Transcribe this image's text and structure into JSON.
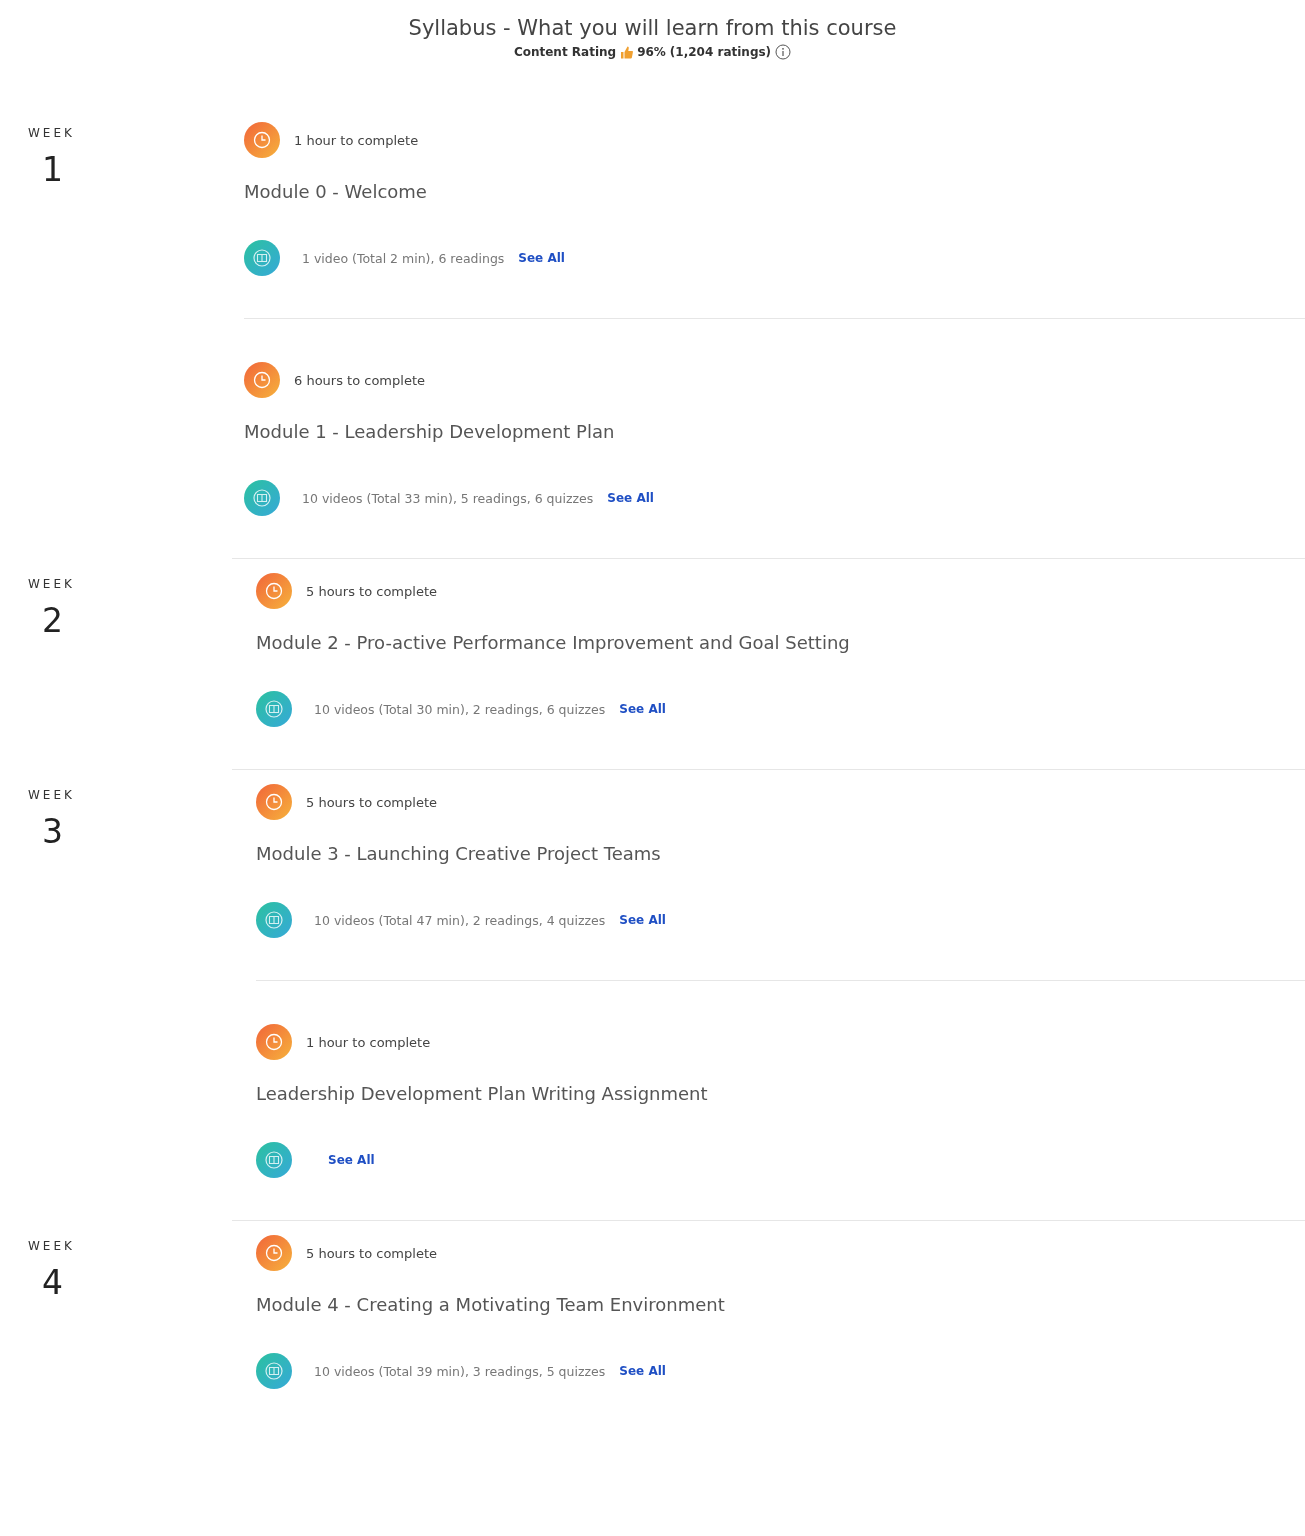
{
  "title": "Syllabus - What you will learn from this course",
  "rating": {
    "label": "Content Rating",
    "value": "96%",
    "count": "(1,204 ratings)"
  },
  "weeks": [
    {
      "label": "WEEK",
      "number": "1",
      "modules": [
        {
          "duration": "1 hour to complete",
          "title": "Module 0 - Welcome",
          "summary": "1 video (Total 2 min), 6 readings",
          "link": "See All"
        },
        {
          "duration": "6 hours to complete",
          "title": "Module 1 - Leadership Development Plan",
          "summary": "10 videos (Total 33 min), 5 readings, 6 quizzes",
          "link": "See All"
        }
      ]
    },
    {
      "label": "WEEK",
      "number": "2",
      "modules": [
        {
          "duration": "5 hours to complete",
          "title": "Module 2 - Pro-active Performance Improvement and Goal Setting",
          "summary": "10 videos (Total 30 min), 2 readings, 6 quizzes",
          "link": "See All"
        }
      ]
    },
    {
      "label": "WEEK",
      "number": "3",
      "modules": [
        {
          "duration": "5 hours to complete",
          "title": "Module 3 - Launching Creative Project Teams",
          "summary": "10 videos (Total 47 min), 2 readings, 4 quizzes",
          "link": "See All"
        },
        {
          "duration": "1 hour to complete",
          "title": "Leadership Development Plan Writing Assignment",
          "link": "See All"
        }
      ]
    },
    {
      "label": "WEEK",
      "number": "4",
      "modules": [
        {
          "duration": "5 hours to complete",
          "title": "Module 4 - Creating a Motivating Team Environment",
          "summary": "10 videos (Total 39 min), 3 readings, 5 quizzes",
          "link": "See All"
        }
      ]
    }
  ]
}
